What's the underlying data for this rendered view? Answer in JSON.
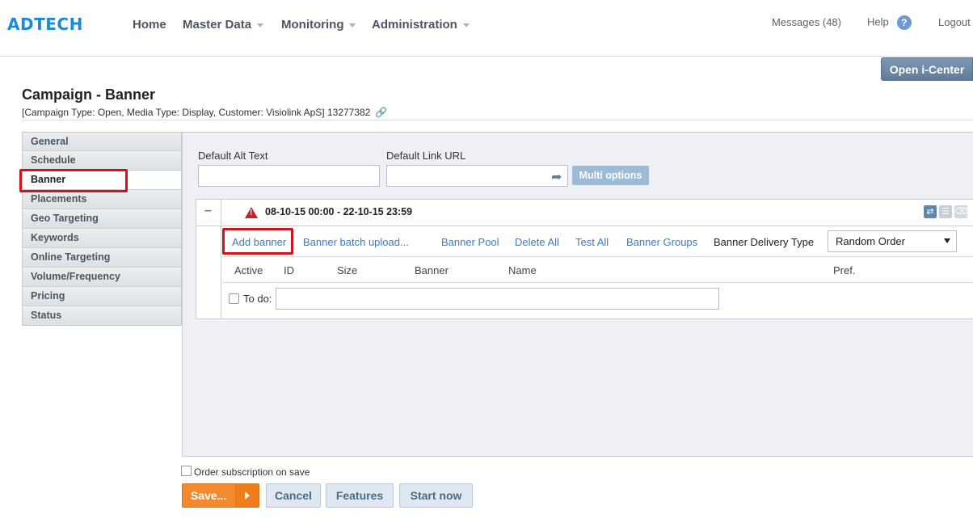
{
  "header": {
    "logo": "ADTECH",
    "nav": [
      {
        "label": "Home",
        "dropdown": false
      },
      {
        "label": "Master Data",
        "dropdown": true
      },
      {
        "label": "Monitoring",
        "dropdown": true
      },
      {
        "label": "Administration",
        "dropdown": true
      }
    ],
    "messages": "Messages (48)",
    "help": "Help",
    "help_icon": "?",
    "logout": "Logout"
  },
  "open_icenter": "Open i-Center",
  "page": {
    "title": "Campaign - Banner",
    "subtitle": "[Campaign Type: Open, Media Type: Display, Customer: Visiolink ApS] 13277382"
  },
  "sidebar": {
    "items": [
      {
        "label": "General"
      },
      {
        "label": "Schedule"
      },
      {
        "label": "Banner"
      },
      {
        "label": "Placements"
      },
      {
        "label": "Geo Targeting"
      },
      {
        "label": "Keywords"
      },
      {
        "label": "Online Targeting"
      },
      {
        "label": "Volume/Frequency"
      },
      {
        "label": "Pricing"
      },
      {
        "label": "Status"
      }
    ],
    "active": "Banner"
  },
  "form": {
    "alt_text_label": "Default Alt Text",
    "alt_text_value": "",
    "link_url_label": "Default Link URL",
    "link_url_value": "",
    "multi_options": "Multi options"
  },
  "schedule_panel": {
    "collapse": "–",
    "date_range": "08-10-15 00:00 - 22-10-15 23:59",
    "actions": {
      "add_banner": "Add banner",
      "batch_upload": "Banner batch upload...",
      "pool": "Banner Pool",
      "delete_all": "Delete All",
      "test_all": "Test All",
      "groups": "Banner Groups"
    },
    "delivery_type_label": "Banner Delivery Type",
    "delivery_type_value": "Random Order",
    "columns": [
      "Active",
      "ID",
      "Size",
      "Banner",
      "Name",
      "Pref."
    ],
    "todo_label": "To do:",
    "todo_value": ""
  },
  "footer": {
    "order_subscription": "Order subscription on save",
    "save": "Save...",
    "cancel": "Cancel",
    "features": "Features",
    "start_now": "Start now"
  },
  "colors": {
    "brand": "#1a8ad6",
    "highlight": "#d0141e",
    "save": "#f28b2f",
    "link": "#3a7bc8"
  }
}
